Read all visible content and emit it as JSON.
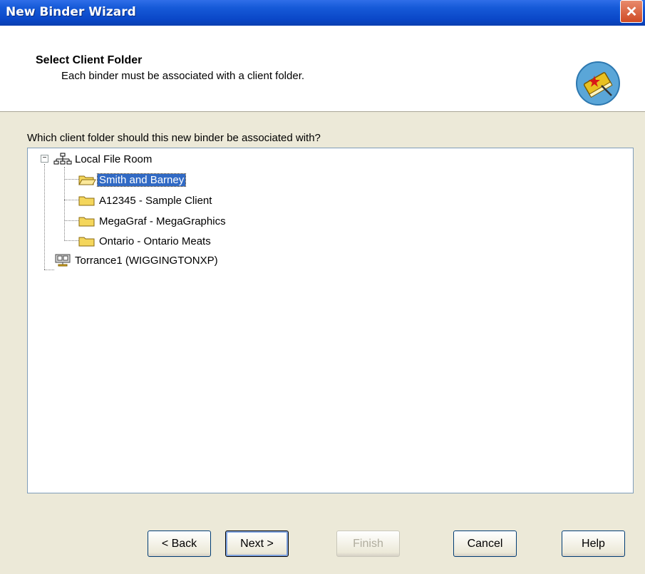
{
  "window": {
    "title": "New Binder Wizard",
    "close_glyph": "✕"
  },
  "header": {
    "title": "Select Client Folder",
    "subtitle": "Each binder must be associated with a client folder.",
    "icon": "book-wizard-icon"
  },
  "question": "Which client  folder should this new binder be associated with?",
  "tree": {
    "root": {
      "label": "Local File Room",
      "expanded": true,
      "icon": "network-icon",
      "expander": "−"
    },
    "children": [
      {
        "label": "Smith and Barney",
        "selected": true,
        "icon": "folder-open-icon"
      },
      {
        "label": "A12345 - Sample Client",
        "selected": false,
        "icon": "folder-icon"
      },
      {
        "label": "MegaGraf - MegaGraphics",
        "selected": false,
        "icon": "folder-icon"
      },
      {
        "label": "Ontario - Ontario Meats",
        "selected": false,
        "icon": "folder-icon"
      }
    ],
    "second_root": {
      "label": "Torrance1 (WIGGINGTONXP)",
      "icon": "computer-icon"
    }
  },
  "buttons": {
    "back": "< Back",
    "next": "Next >",
    "finish": "Finish",
    "cancel": "Cancel",
    "help": "Help"
  },
  "colors": {
    "title_bar": "#0a47c8",
    "selection": "#316ac5",
    "dialog_bg": "#ece9d8"
  }
}
